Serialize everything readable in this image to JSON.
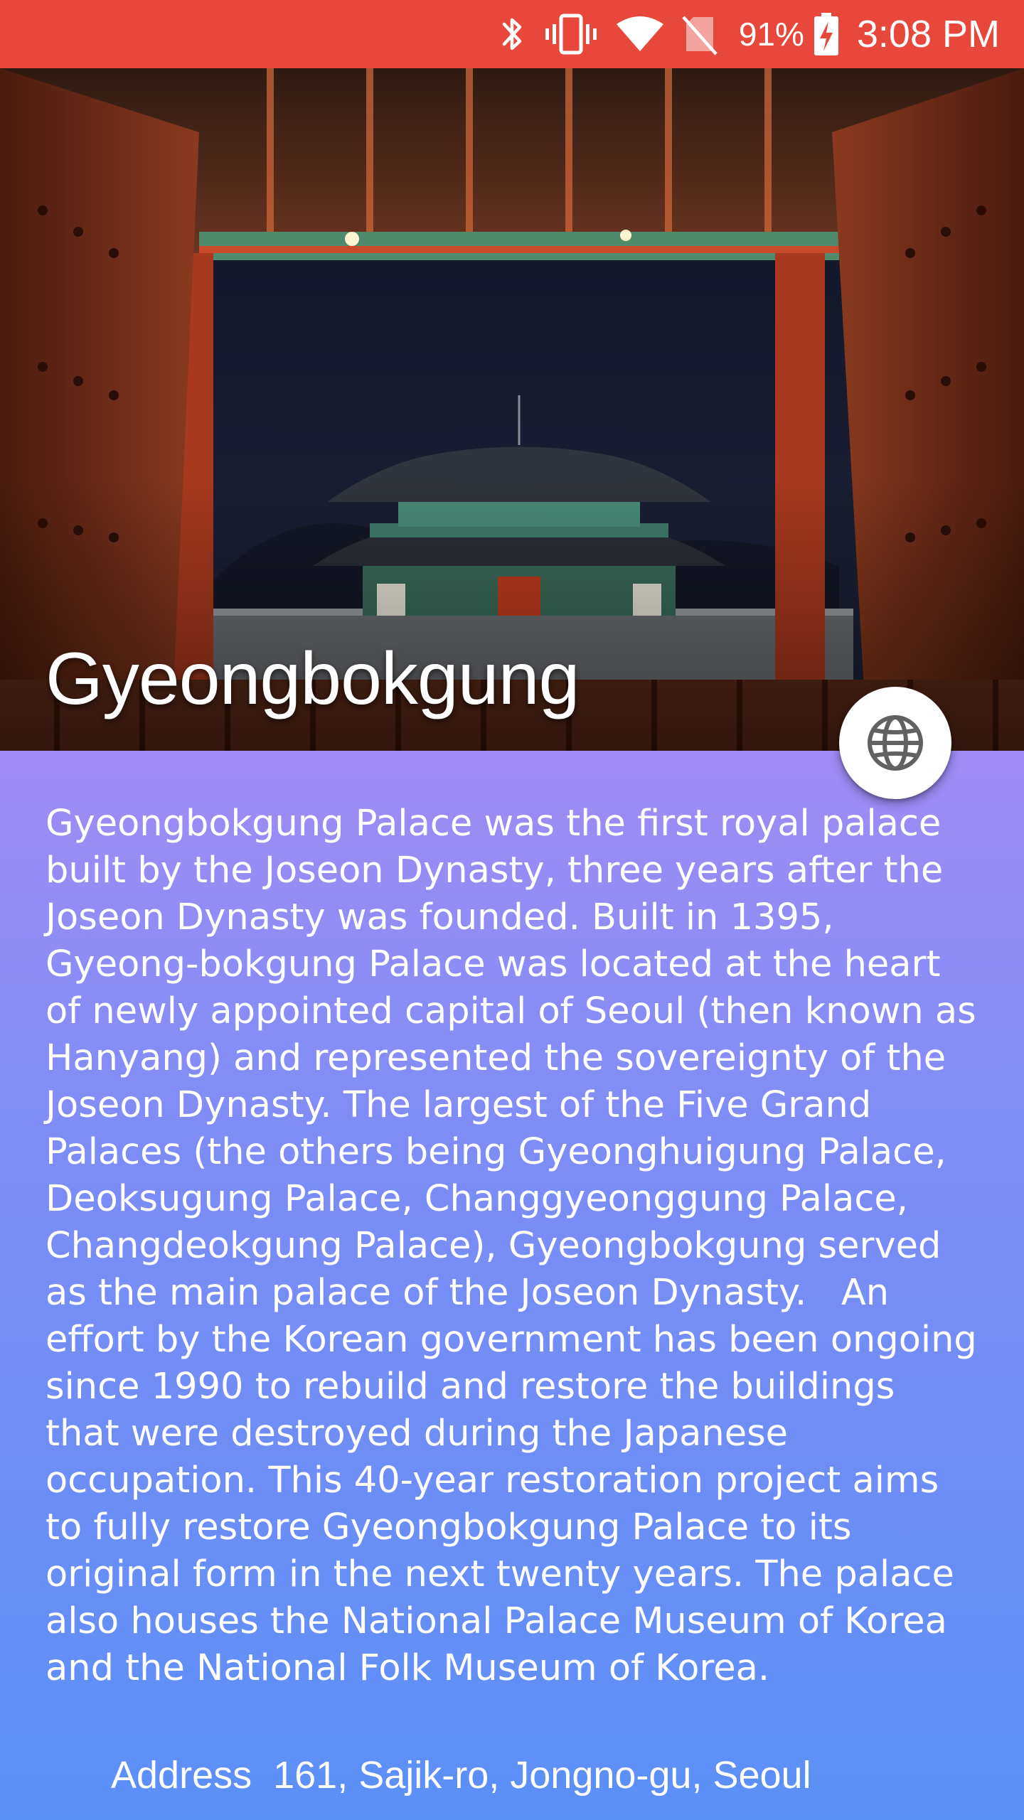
{
  "status_bar": {
    "battery_percent": "91%",
    "time": "3:08 PM",
    "background_color": "#e8483c",
    "icons": [
      "bluetooth-icon",
      "vibrate-icon",
      "wifi-icon",
      "no-sim-icon",
      "battery-charging-icon"
    ]
  },
  "hero": {
    "title": "Gyeongbokgung"
  },
  "fab": {
    "icon": "globe-icon"
  },
  "content": {
    "description": "Gyeongbokgung Palace was the first royal palace built by the Joseon Dynasty, three years after the Joseon Dynasty was founded. Built in 1395, Gyeong-bokgung Palace was located at the heart of newly appointed capital of Seoul (then known as Hanyang) and represented the sovereignty of the Joseon Dynasty. The largest of the Five Grand Palaces (the others being Gyeonghuigung Palace, Deoksugung Palace, Changgyeonggung Palace, Changdeokgung Palace), Gyeongbokgung served as the main palace of the Joseon Dynasty.   An effort by the Korean government has been ongoing since 1990 to rebuild and restore the buildings that were destroyed during the Japanese occupation. This 40-year restoration project aims to fully restore Gyeongbokgung Palace to its original form in the next twenty years. The palace also houses the National Palace Museum of Korea and the National Folk Museum of Korea.",
    "address": "Address  161, Sajik-ro, Jongno-gu, Seoul",
    "gradient_top": "#a18cf5",
    "gradient_bottom": "#5b90f7"
  }
}
